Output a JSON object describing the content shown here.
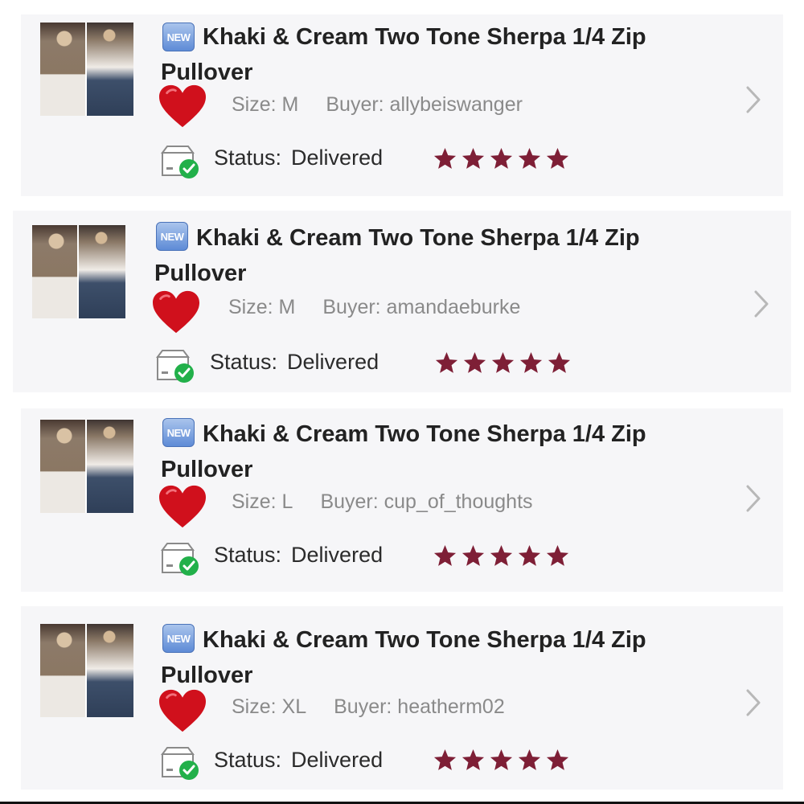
{
  "colors": {
    "card_bg": "#f6f6f8",
    "star": "#7e1f36",
    "heart": "#d0101c",
    "check": "#22b04a",
    "chevron": "#b8b8b8"
  },
  "orders": [
    {
      "badge": "NEW",
      "title": "Khaki & Cream Two Tone Sherpa 1/4 Zip Pullover",
      "size": "Size: M",
      "buyer": "Buyer: allybeiswanger",
      "status_label": "Status:",
      "status_value": "Delivered",
      "rating": 5
    },
    {
      "badge": "NEW",
      "title": "Khaki & Cream Two Tone Sherpa 1/4 Zip Pullover",
      "size": "Size: M",
      "buyer": "Buyer: amandaeburke",
      "status_label": "Status:",
      "status_value": "Delivered",
      "rating": 5
    },
    {
      "badge": "NEW",
      "title": "Khaki & Cream Two Tone Sherpa 1/4 Zip Pullover",
      "size": "Size: L",
      "buyer": "Buyer: cup_of_thoughts",
      "status_label": "Status:",
      "status_value": "Delivered",
      "rating": 5
    },
    {
      "badge": "NEW",
      "title": "Khaki & Cream Two Tone Sherpa 1/4 Zip Pullover",
      "size": "Size: XL",
      "buyer": "Buyer: heatherm02",
      "status_label": "Status:",
      "status_value": "Delivered",
      "rating": 5
    }
  ],
  "icons": {
    "thumbnail": "product-photo",
    "badge": "new-badge-icon",
    "heart": "heart-icon",
    "box": "package-delivered-icon",
    "star": "star-icon",
    "chevron": "chevron-right-icon"
  }
}
